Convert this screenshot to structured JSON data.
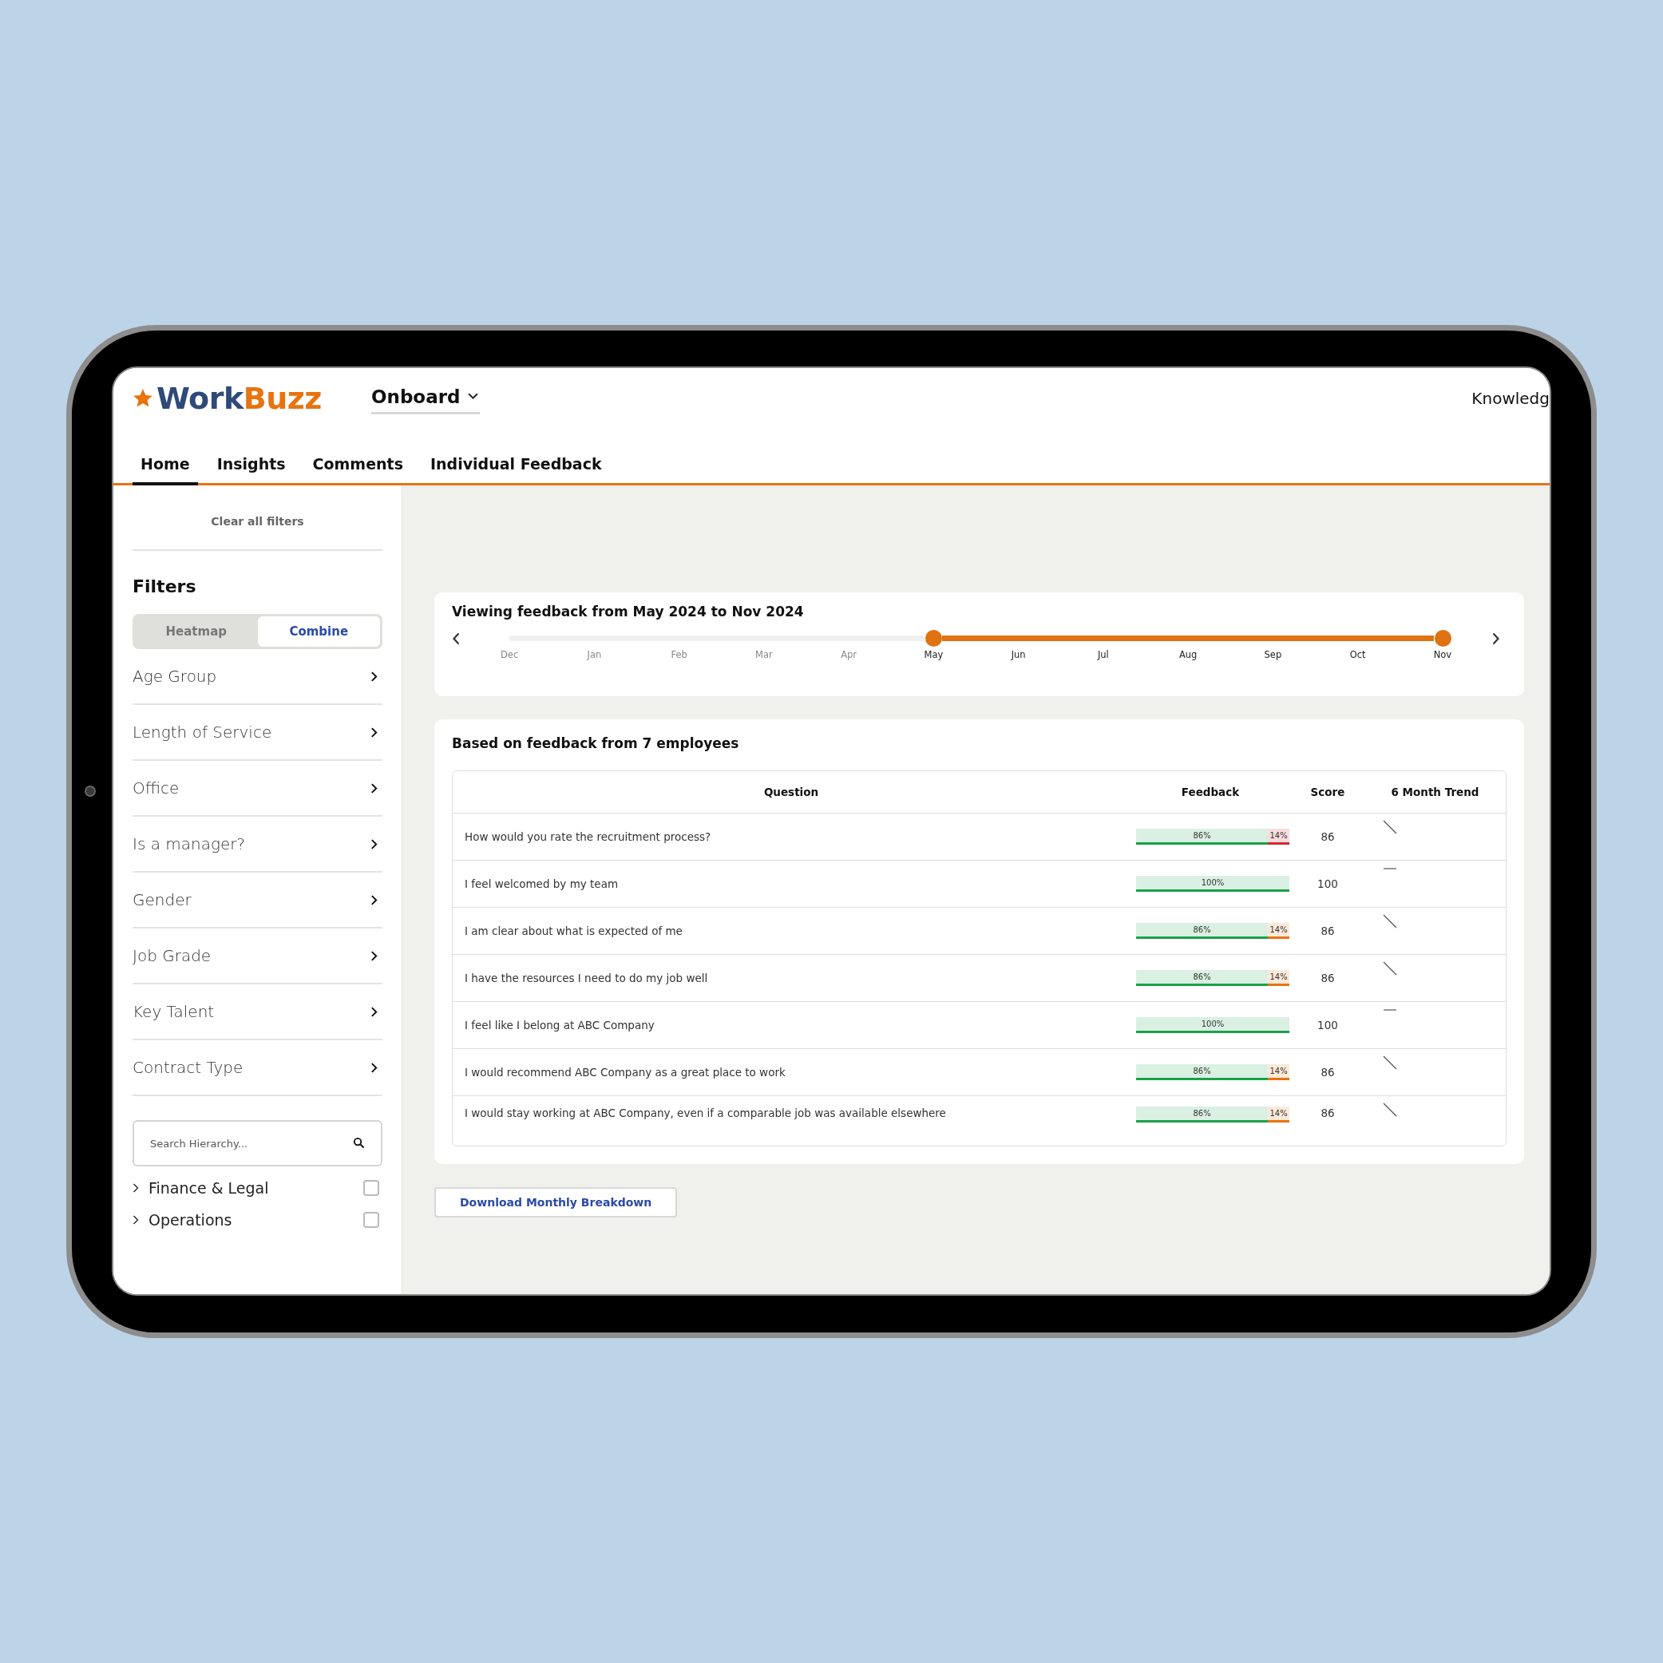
{
  "header": {
    "logo": {
      "part1": "Work",
      "part2": "Buzz"
    },
    "product_menu": {
      "label": "Onboard"
    },
    "right_link": "Knowledg"
  },
  "tabs": [
    {
      "label": "Home",
      "selected": true
    },
    {
      "label": "Insights",
      "selected": false
    },
    {
      "label": "Comments",
      "selected": false
    },
    {
      "label": "Individual Feedback",
      "selected": false
    }
  ],
  "sidebar": {
    "clear_filters": "Clear all filters",
    "title": "Filters",
    "view_toggle": [
      {
        "label": "Heatmap",
        "selected": false
      },
      {
        "label": "Combine",
        "selected": true
      }
    ],
    "filters": [
      "Age Group",
      "Length of Service",
      "Office",
      "Is a manager?",
      "Gender",
      "Job Grade",
      "Key Talent",
      "Contract Type"
    ],
    "hierarchy_search": {
      "placeholder": "Search Hierarchy..."
    },
    "hierarchy": [
      {
        "label": "Finance & Legal",
        "expanded": false,
        "checked": false
      },
      {
        "label": "Operations",
        "expanded": false,
        "checked": false
      }
    ]
  },
  "timeline": {
    "title": "Viewing feedback from May 2024 to Nov 2024",
    "months": [
      {
        "label": "Dec",
        "in_range": false
      },
      {
        "label": "Jan",
        "in_range": false
      },
      {
        "label": "Feb",
        "in_range": false
      },
      {
        "label": "Mar",
        "in_range": false
      },
      {
        "label": "Apr",
        "in_range": false
      },
      {
        "label": "May",
        "in_range": true
      },
      {
        "label": "Jun",
        "in_range": true
      },
      {
        "label": "Jul",
        "in_range": true
      },
      {
        "label": "Aug",
        "in_range": true
      },
      {
        "label": "Sep",
        "in_range": true
      },
      {
        "label": "Oct",
        "in_range": true
      },
      {
        "label": "Nov",
        "in_range": true
      }
    ]
  },
  "results": {
    "title": "Based on feedback from 7 employees",
    "columns": [
      "Question",
      "Feedback",
      "Score",
      "6 Month Trend"
    ],
    "rows": [
      {
        "question": "How would you rate the recruitment process?",
        "feedback": {
          "positive": {
            "label": "86%",
            "level": 0.86,
            "color": "#1aa04a"
          },
          "negative": {
            "label": "14%",
            "color": "#d9262e"
          }
        },
        "score": "86",
        "trend": {
          "kind": "down"
        }
      },
      {
        "question": "I feel welcomed by my team",
        "feedback": {
          "positive": {
            "label": "100%",
            "level": 1,
            "color": "#1aa04a"
          }
        },
        "score": "100",
        "trend": {
          "kind": "flat"
        }
      },
      {
        "question": "I am clear about what is expected of me",
        "feedback": {
          "positive": {
            "label": "86%",
            "level": 0.86,
            "color": "#1aa04a"
          },
          "negative": {
            "label": "14%",
            "color": "#e8730f"
          }
        },
        "score": "86",
        "trend": {
          "kind": "down"
        }
      },
      {
        "question": "I have the resources I need to do my job well",
        "feedback": {
          "positive": {
            "label": "86%",
            "level": 0.86,
            "color": "#1aa04a"
          },
          "negative": {
            "label": "14%",
            "color": "#e8730f"
          }
        },
        "score": "86",
        "trend": {
          "kind": "down"
        }
      },
      {
        "question": "I feel like I belong at ABC Company",
        "feedback": {
          "positive": {
            "label": "100%",
            "level": 1,
            "color": "#1aa04a"
          }
        },
        "score": "100",
        "trend": {
          "kind": "flat"
        }
      },
      {
        "question": "I would recommend ABC Company as a great place to work",
        "feedback": {
          "positive": {
            "label": "86%",
            "level": 0.86,
            "color": "#1aa04a"
          },
          "negative": {
            "label": "14%",
            "color": "#e8730f"
          }
        },
        "score": "86",
        "trend": {
          "kind": "down"
        }
      },
      {
        "question": "I would stay working at ABC Company, even if a comparable job was available elsewhere",
        "feedback": {
          "positive": {
            "label": "86%",
            "level": 0.86,
            "color": "#1aa04a"
          },
          "negative": {
            "label": "14%",
            "color": "#e8730f"
          }
        },
        "score": "86",
        "trend": {
          "kind": "down"
        }
      }
    ]
  },
  "download_button": "Download Monthly Breakdown"
}
